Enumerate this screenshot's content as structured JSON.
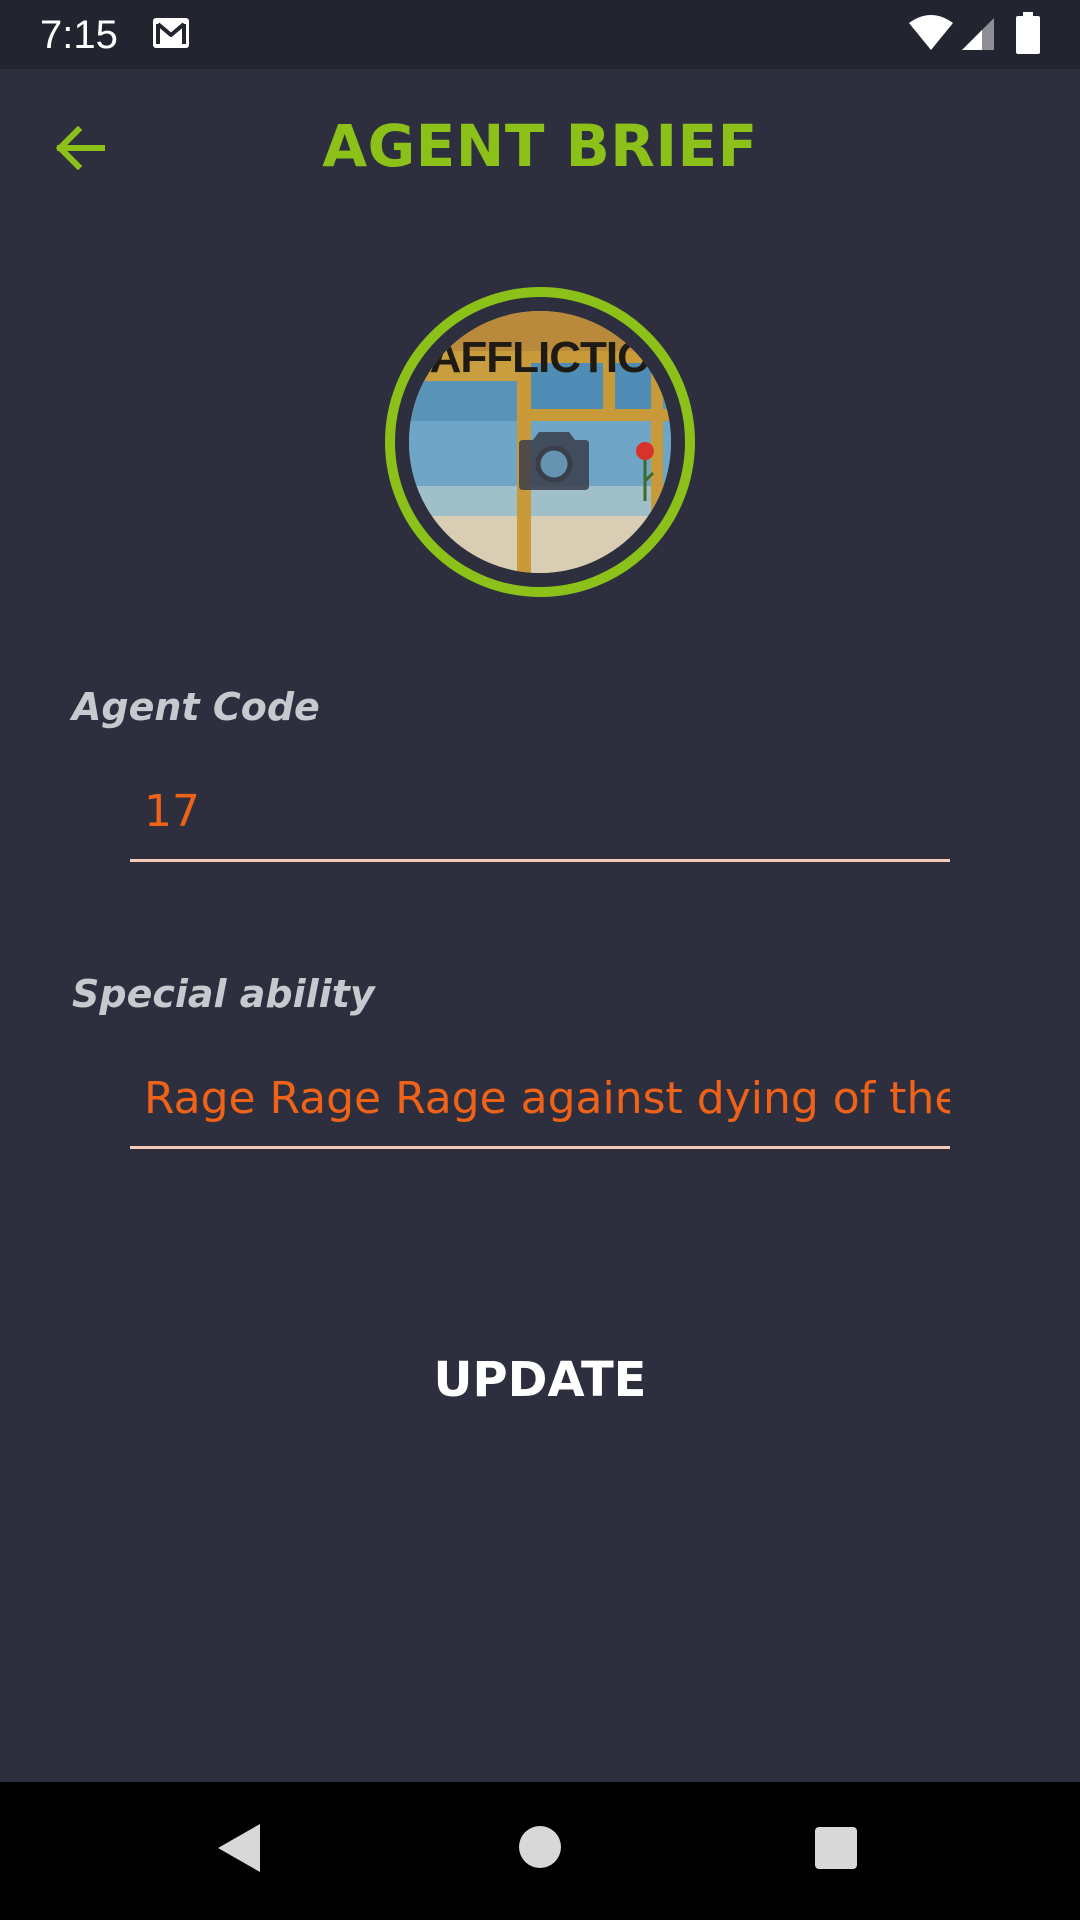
{
  "status_bar": {
    "time": "7:15",
    "icons": [
      "gmail-icon",
      "wifi-icon",
      "signal-icon",
      "battery-icon"
    ]
  },
  "header": {
    "title": "AGENT BRIEF",
    "back_icon": "arrow-left-icon"
  },
  "avatar": {
    "photo_text": "AFFLICTIO",
    "overlay_icon": "camera-icon"
  },
  "fields": {
    "agent_code": {
      "label": "Agent Code",
      "value": "17"
    },
    "special_ability": {
      "label": "Special ability",
      "value": "Rage Rage Rage against dying of the light"
    }
  },
  "actions": {
    "update_label": "UPDATE"
  },
  "nav_bar": {
    "icons": [
      "nav-back-icon",
      "nav-home-icon",
      "nav-recents-icon"
    ]
  },
  "colors": {
    "background": "#2d2f3e",
    "accent": "#8cc11a",
    "input_text": "#ef6218",
    "input_underline": "#f2c8b6",
    "label": "#c8c9cf"
  }
}
